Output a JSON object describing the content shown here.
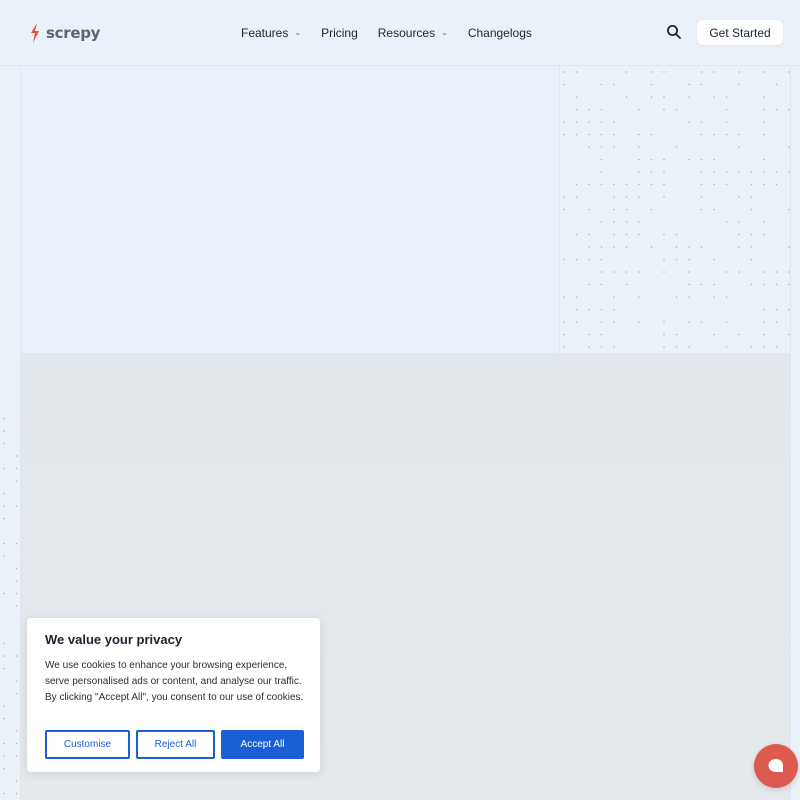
{
  "brand": {
    "name": "screpy",
    "accent": "#ef4a3c"
  },
  "nav": {
    "items": [
      {
        "label": "Features",
        "has_dropdown": true
      },
      {
        "label": "Pricing",
        "has_dropdown": false
      },
      {
        "label": "Resources",
        "has_dropdown": true
      },
      {
        "label": "Changelogs",
        "has_dropdown": false
      }
    ],
    "search_icon": "search-icon",
    "cta_label": "Get Started"
  },
  "cookie_banner": {
    "title": "We value your privacy",
    "text": "We use cookies to enhance your browsing experience, serve personalised ads or content, and analyse our traffic. By clicking \"Accept All\", you consent to our use of cookies.",
    "customise_label": "Customise",
    "reject_label": "Reject All",
    "accept_label": "Accept All",
    "button_color": "#1a5fd6"
  },
  "chat": {
    "icon": "chat-bubble-icon",
    "color": "#dd5a4e"
  }
}
